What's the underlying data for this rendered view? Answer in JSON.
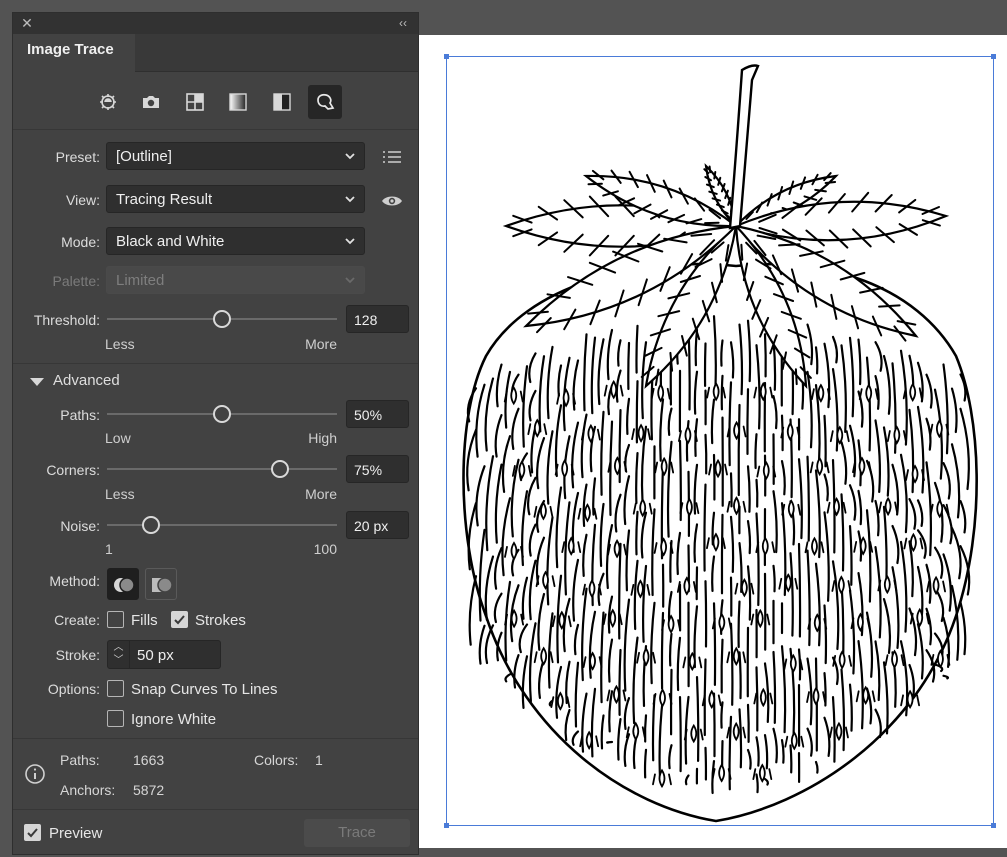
{
  "panel": {
    "tab_title": "Image Trace",
    "close_icon": "close-icon",
    "collapse_icon": "double-chevron-left-icon",
    "preset_icons": [
      "auto-color-icon",
      "camera-icon",
      "low-color-icon",
      "grayscale-icon",
      "black-white-icon",
      "outline-icon"
    ],
    "selected_preset_icon": "outline-icon"
  },
  "preset": {
    "label": "Preset:",
    "value": "[Outline]",
    "side_icon": "list-menu-icon"
  },
  "view": {
    "label": "View:",
    "value": "Tracing Result",
    "side_icon": "eye-icon"
  },
  "mode": {
    "label": "Mode:",
    "value": "Black and White"
  },
  "palette": {
    "label": "Palette:",
    "value": "Limited",
    "disabled": true
  },
  "threshold": {
    "label": "Threshold:",
    "value": "128",
    "level": 128,
    "min": 0,
    "max": 255,
    "low_label": "Less",
    "high_label": "More"
  },
  "advanced": {
    "label": "Advanced",
    "expanded": true
  },
  "paths": {
    "label": "Paths:",
    "value": "50%",
    "level": 50,
    "min": 0,
    "max": 100,
    "low_label": "Low",
    "high_label": "High"
  },
  "corners": {
    "label": "Corners:",
    "value": "75%",
    "level": 75,
    "min": 0,
    "max": 100,
    "low_label": "Less",
    "high_label": "More"
  },
  "noise": {
    "label": "Noise:",
    "value": "20 px",
    "level": 20,
    "min": 1,
    "max": 100,
    "low_label": "1",
    "high_label": "100"
  },
  "method": {
    "label": "Method:",
    "options": [
      "abutting-method-icon",
      "overlapping-method-icon"
    ],
    "selected": "abutting-method-icon"
  },
  "create": {
    "label": "Create:",
    "fills_label": "Fills",
    "fills_checked": false,
    "strokes_label": "Strokes",
    "strokes_checked": true
  },
  "stroke": {
    "label": "Stroke:",
    "value": "50 px"
  },
  "options": {
    "label": "Options:",
    "snap_label": "Snap Curves To Lines",
    "snap_checked": false,
    "ignore_white_label": "Ignore White",
    "ignore_white_checked": false
  },
  "stats": {
    "info_icon": "info-icon",
    "paths_label": "Paths:",
    "paths_value": "1663",
    "colors_label": "Colors:",
    "colors_value": "1",
    "anchors_label": "Anchors:",
    "anchors_value": "5872"
  },
  "footer": {
    "preview_label": "Preview",
    "preview_checked": true,
    "trace_label": "Trace",
    "trace_disabled": true
  },
  "colors": {
    "panel_bg": "#424242",
    "canvas_bg": "#535353",
    "selection": "#4a7bd8",
    "field_bg": "#2f2f2f"
  }
}
